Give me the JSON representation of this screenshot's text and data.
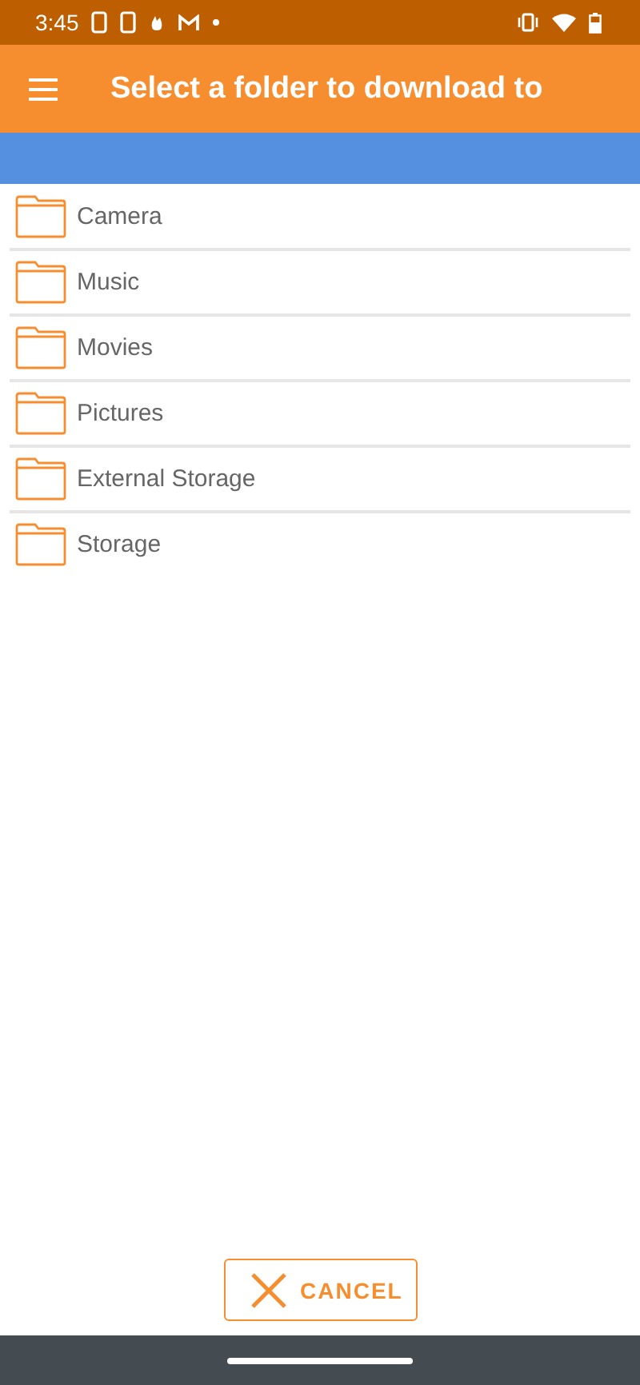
{
  "status_bar": {
    "time": "3:45"
  },
  "app_bar": {
    "title": "Select a folder to download to"
  },
  "folders": [
    {
      "name": "Camera"
    },
    {
      "name": "Music"
    },
    {
      "name": "Movies"
    },
    {
      "name": "Pictures"
    },
    {
      "name": "External Storage"
    },
    {
      "name": "Storage"
    }
  ],
  "cancel_button": {
    "label": "CANCEL"
  }
}
